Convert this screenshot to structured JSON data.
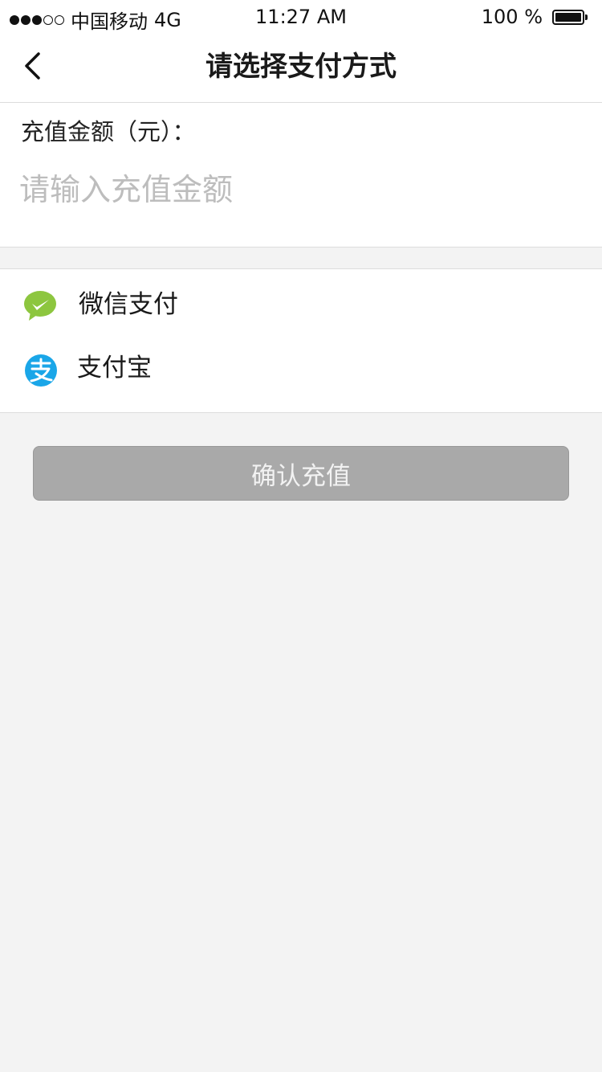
{
  "status_bar": {
    "carrier": "中国移动",
    "network": "4G",
    "time": "11:27 AM",
    "battery": "100 %"
  },
  "nav": {
    "title": "请选择支付方式",
    "back_icon": "chevron-left-icon"
  },
  "amount": {
    "label": "充值金额（元）：",
    "placeholder": "请输入充值金额",
    "value": ""
  },
  "payment_methods": [
    {
      "label": "微信支付",
      "icon": "wechat-icon",
      "color": "#8dc63f"
    },
    {
      "label": "支付宝",
      "icon": "alipay-icon",
      "color": "#1aa6e8"
    }
  ],
  "confirm": {
    "label": "确认充值",
    "color": "#a9a9a9"
  }
}
